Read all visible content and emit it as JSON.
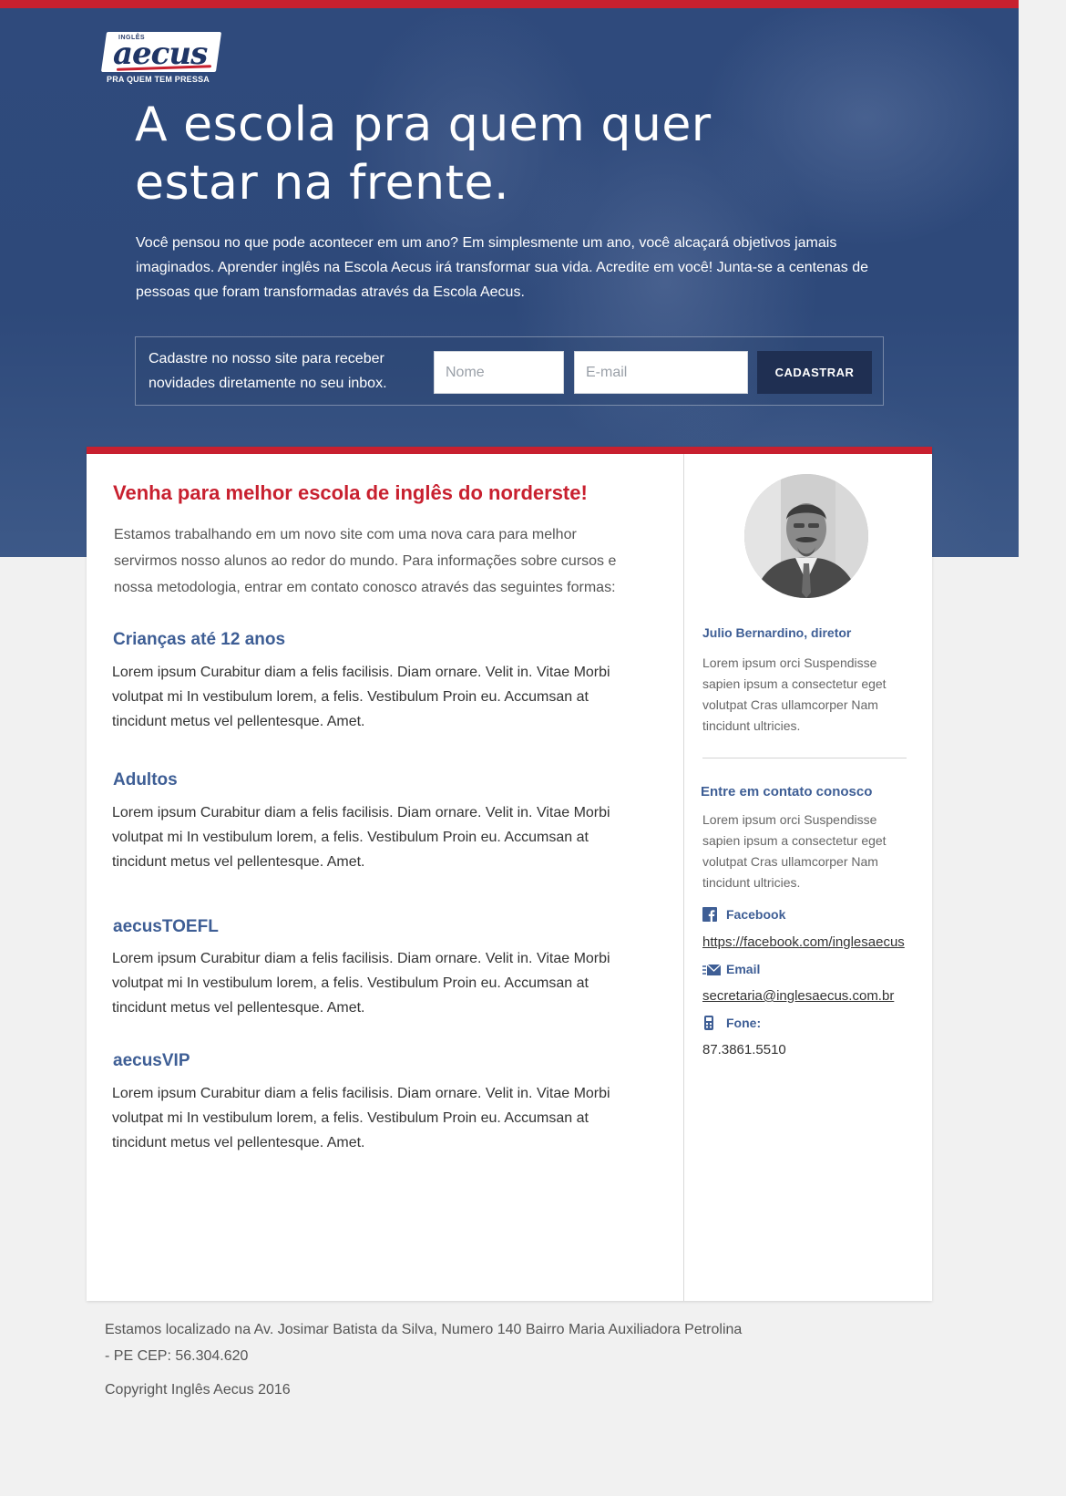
{
  "colors": {
    "accent_red": "#c8202f",
    "hero_blue": "#2f4a7c",
    "heading_blue": "#3e5e95",
    "button_navy": "#1f2f52",
    "page_bg": "#f1f1f1"
  },
  "logo": {
    "small_text": "INGLÊS",
    "brand": "aecus",
    "tagline": "PRA QUEM TEM PRESSA"
  },
  "hero": {
    "title": "A escola pra quem quer estar na frente.",
    "text": "Você pensou no que pode acontecer em um ano? Em simplesmente um ano, você alcaçará objetivos jamais imaginados. Aprender inglês na Escola Aecus irá transformar sua vida. Acredite em você!  Junta-se a centenas de pessoas que foram transformadas através da Escola Aecus."
  },
  "signup": {
    "text": "Cadastre no nosso site para receber novidades diretamente no seu inbox.",
    "name_placeholder": "Nome",
    "email_placeholder": "E-mail",
    "button": "CADASTRAR"
  },
  "main": {
    "title": "Venha para melhor escola de inglês do norderste!",
    "intro": "Estamos trabalhando em um novo site com uma nova cara para melhor servirmos nosso alunos ao redor do mundo. Para informações sobre cursos e nossa metodologia, entrar em contato conosco através das seguintes formas:",
    "sections": [
      {
        "title": "Crianças até 12 anos",
        "text": "Lorem ipsum Curabitur diam a felis facilisis. Diam ornare. Velit in. Vitae Morbi volutpat mi In vestibulum lorem, a felis. Vestibulum Proin eu. Accumsan at tincidunt metus vel pellentesque. Amet."
      },
      {
        "title": "Adultos",
        "text": "Lorem ipsum Curabitur diam a felis facilisis. Diam ornare. Velit in. Vitae Morbi volutpat mi In vestibulum lorem, a felis. Vestibulum Proin eu. Accumsan at tincidunt metus vel pellentesque. Amet."
      },
      {
        "title": "aecusTOEFL",
        "text": "Lorem ipsum Curabitur diam a felis facilisis. Diam ornare. Velit in. Vitae Morbi volutpat mi In vestibulum lorem, a felis. Vestibulum Proin eu. Accumsan at tincidunt metus vel pellentesque. Amet."
      },
      {
        "title": "aecusVIP",
        "text": "Lorem ipsum Curabitur diam a felis facilisis. Diam ornare. Velit in. Vitae Morbi volutpat mi In vestibulum lorem, a felis. Vestibulum Proin eu. Accumsan at tincidunt metus vel pellentesque. Amet."
      }
    ]
  },
  "sidebar": {
    "director_name": "Julio Bernardino, diretor",
    "director_text": "Lorem ipsum orci Suspendisse sapien ipsum a consectetur eget volutpat Cras ullamcorper Nam tincidunt ultricies.",
    "contact_heading": "Entre em contato conosco",
    "contact_text": "Lorem ipsum orci Suspendisse sapien ipsum a consectetur eget volutpat Cras ullamcorper Nam tincidunt ultricies.",
    "facebook_label": "Facebook",
    "facebook_url": "https://facebook.com/inglesaecus",
    "email_label": "Email",
    "email_value": "secretaria@inglesaecus.com.br",
    "phone_label": "Fone:",
    "phone_value": "87.3861.5510"
  },
  "footer": {
    "address": "Estamos localizado na Av. Josimar Batista da Silva, Numero 140 Bairro Maria Auxiliadora Petrolina - PE CEP: 56.304.620",
    "copyright": "Copyright Inglês Aecus 2016"
  }
}
